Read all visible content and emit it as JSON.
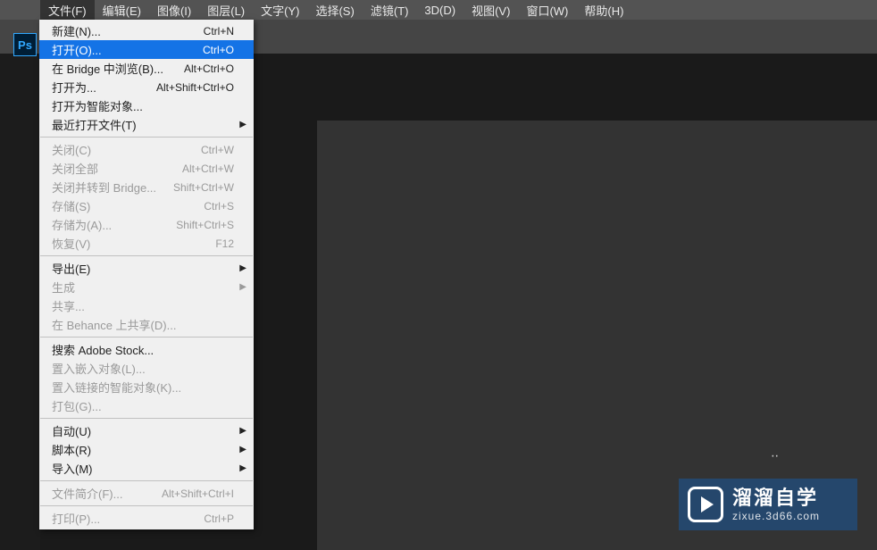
{
  "menubar": {
    "items": [
      {
        "label": "文件(F)",
        "active": true
      },
      {
        "label": "编辑(E)"
      },
      {
        "label": "图像(I)"
      },
      {
        "label": "图层(L)"
      },
      {
        "label": "文字(Y)"
      },
      {
        "label": "选择(S)"
      },
      {
        "label": "滤镜(T)"
      },
      {
        "label": "3D(D)"
      },
      {
        "label": "视图(V)"
      },
      {
        "label": "窗口(W)"
      },
      {
        "label": "帮助(H)"
      }
    ]
  },
  "logo": "Ps",
  "dropdown": {
    "groups": [
      [
        {
          "label": "新建(N)...",
          "shortcut": "Ctrl+N"
        },
        {
          "label": "打开(O)...",
          "shortcut": "Ctrl+O",
          "highlighted": true
        },
        {
          "label": "在 Bridge 中浏览(B)...",
          "shortcut": "Alt+Ctrl+O"
        },
        {
          "label": "打开为...",
          "shortcut": "Alt+Shift+Ctrl+O"
        },
        {
          "label": "打开为智能对象..."
        },
        {
          "label": "最近打开文件(T)",
          "submenu": true
        }
      ],
      [
        {
          "label": "关闭(C)",
          "shortcut": "Ctrl+W",
          "disabled": true
        },
        {
          "label": "关闭全部",
          "shortcut": "Alt+Ctrl+W",
          "disabled": true
        },
        {
          "label": "关闭并转到 Bridge...",
          "shortcut": "Shift+Ctrl+W",
          "disabled": true
        },
        {
          "label": "存储(S)",
          "shortcut": "Ctrl+S",
          "disabled": true
        },
        {
          "label": "存储为(A)...",
          "shortcut": "Shift+Ctrl+S",
          "disabled": true
        },
        {
          "label": "恢复(V)",
          "shortcut": "F12",
          "disabled": true
        }
      ],
      [
        {
          "label": "导出(E)",
          "submenu": true
        },
        {
          "label": "生成",
          "submenu": true,
          "disabled": true
        },
        {
          "label": "共享...",
          "disabled": true
        },
        {
          "label": "在 Behance 上共享(D)...",
          "disabled": true
        }
      ],
      [
        {
          "label": "搜索 Adobe Stock..."
        },
        {
          "label": "置入嵌入对象(L)...",
          "disabled": true
        },
        {
          "label": "置入链接的智能对象(K)...",
          "disabled": true
        },
        {
          "label": "打包(G)...",
          "disabled": true
        }
      ],
      [
        {
          "label": "自动(U)",
          "submenu": true
        },
        {
          "label": "脚本(R)",
          "submenu": true
        },
        {
          "label": "导入(M)",
          "submenu": true
        }
      ],
      [
        {
          "label": "文件简介(F)...",
          "shortcut": "Alt+Shift+Ctrl+I",
          "disabled": true
        }
      ],
      [
        {
          "label": "打印(P)...",
          "shortcut": "Ctrl+P",
          "disabled": true
        }
      ]
    ]
  },
  "watermark": {
    "title": "溜溜自学",
    "sub": "zixue.3d66.com"
  }
}
